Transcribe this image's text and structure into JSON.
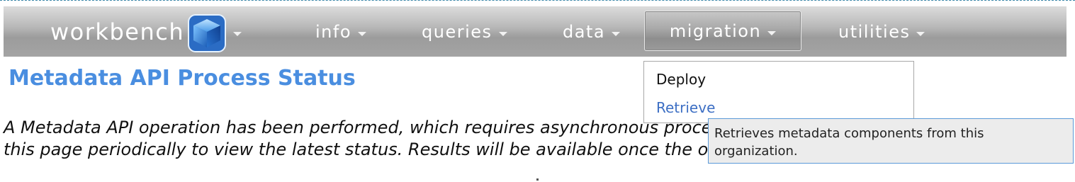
{
  "app": {
    "logo_text": "workbench"
  },
  "nav": {
    "items": [
      {
        "label": "info"
      },
      {
        "label": "queries"
      },
      {
        "label": "data"
      },
      {
        "label": "migration"
      },
      {
        "label": "utilities"
      }
    ]
  },
  "main": {
    "title": "Metadata API Process Status",
    "description": "A Metadata API operation has been performed, which requires asynchronous processing as resources are available. Refresh this page periodically to view the latest status. Results will be available once the operation is complete."
  },
  "migration_menu": {
    "items": [
      {
        "label": "Deploy"
      },
      {
        "label": "Retrieve"
      }
    ]
  },
  "tooltip": {
    "text": "Retrieves metadata components from this organization."
  },
  "colors": {
    "title": "#4a8ee0",
    "link_hover": "#3d6fc4",
    "tooltip_border": "#5b9ad8"
  }
}
